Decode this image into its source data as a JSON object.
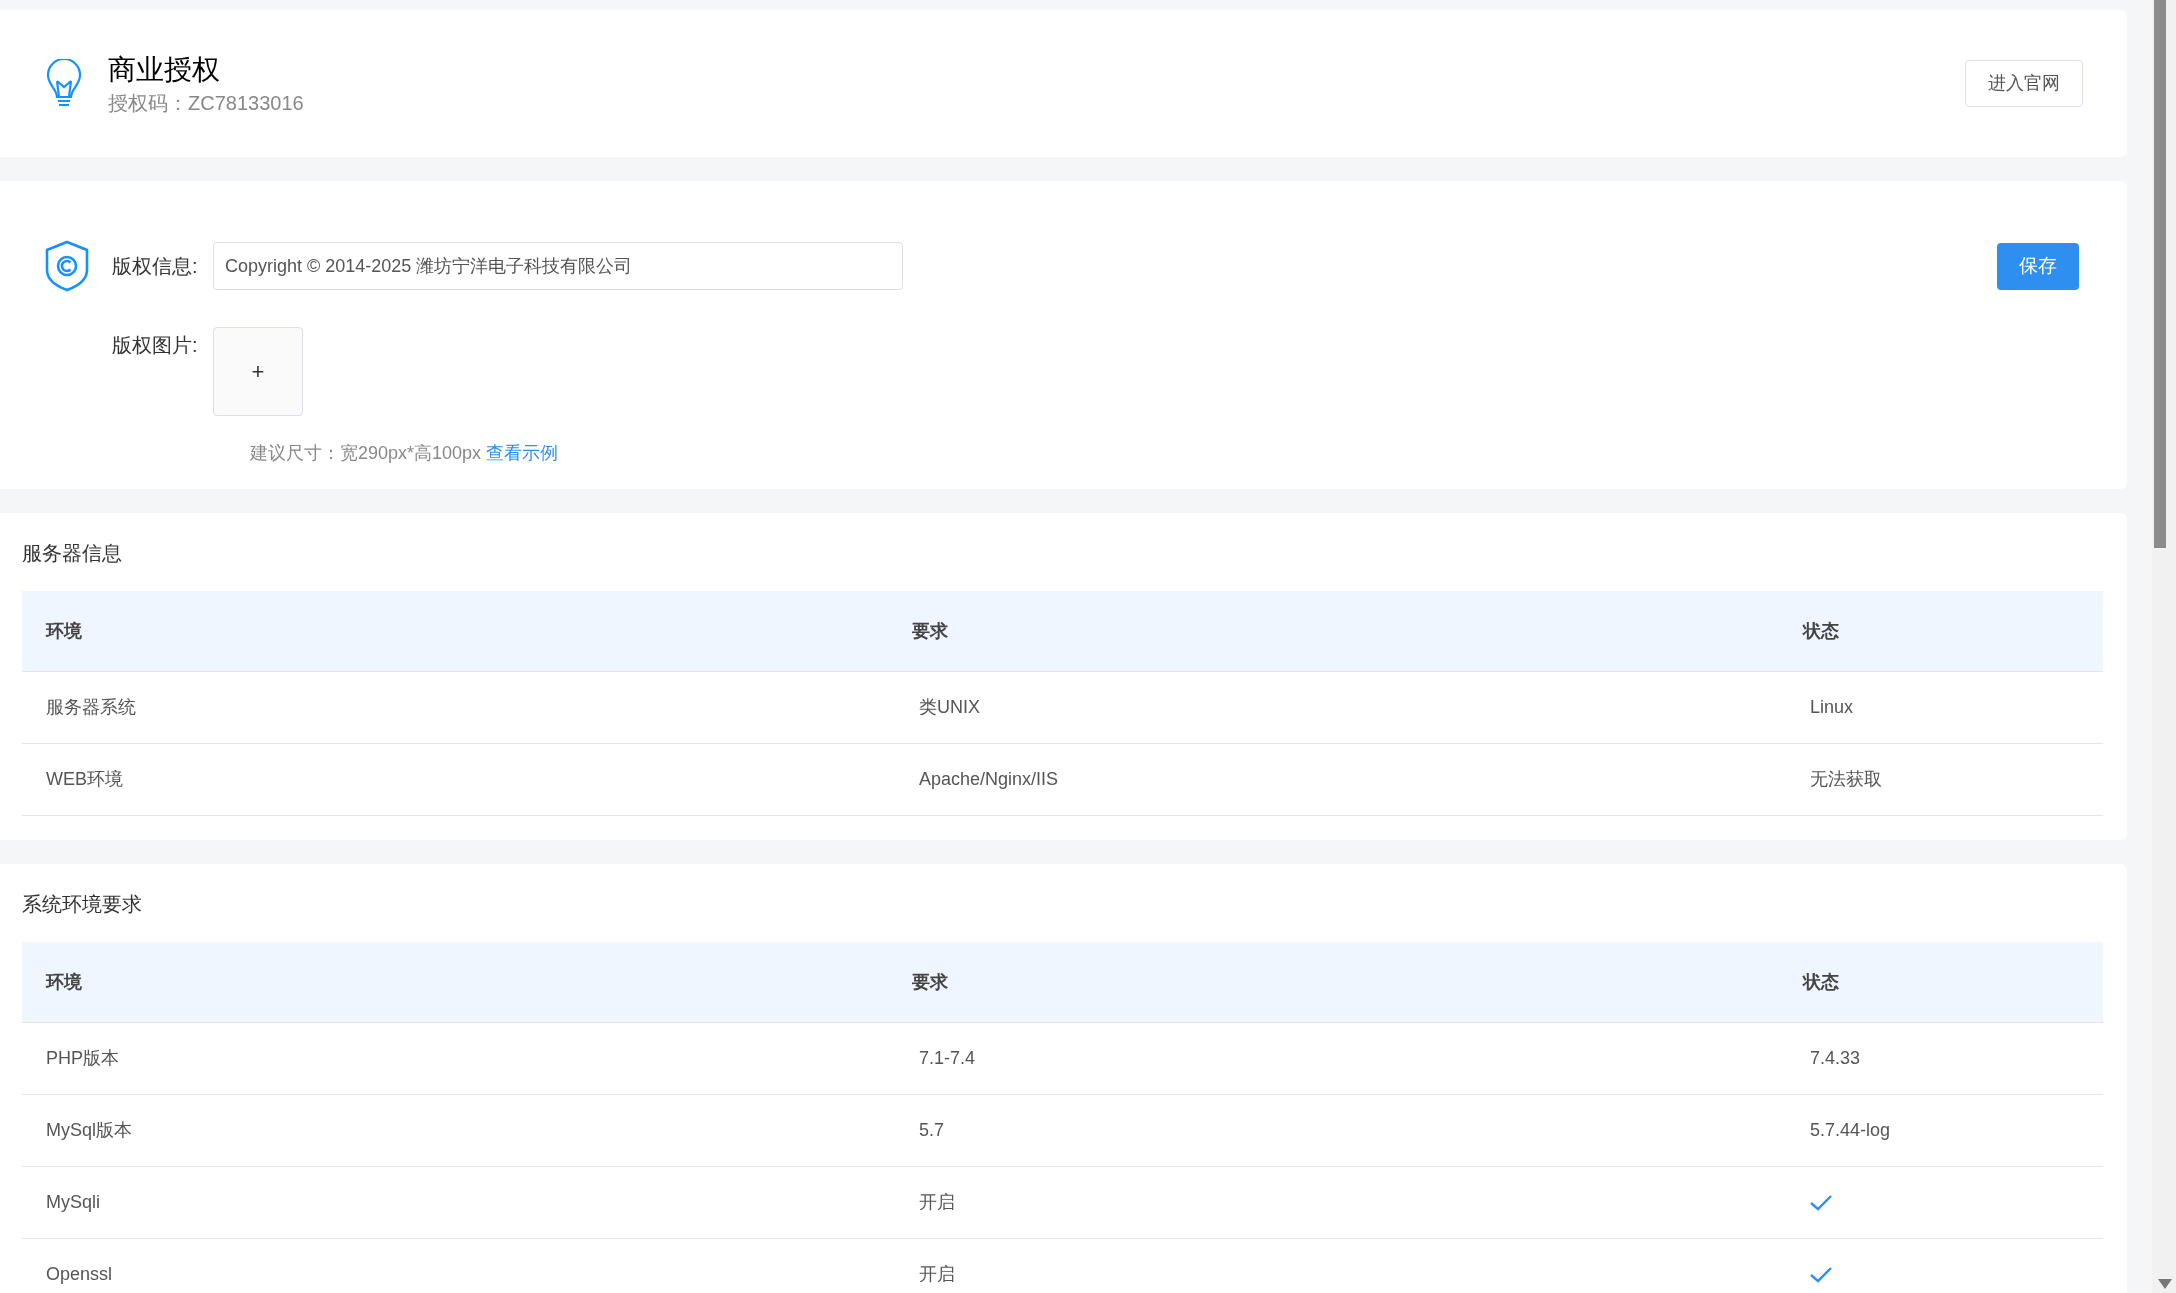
{
  "license": {
    "title": "商业授权",
    "code": "授权码：ZC78133016",
    "button": "进入官网"
  },
  "copyright": {
    "info_label": "版权信息:",
    "info_value": "Copyright © 2014-2025 潍坊宁洋电子科技有限公司",
    "save_button": "保存",
    "image_label": "版权图片:",
    "upload_symbol": "+",
    "hint": "建议尺寸：宽290px*高100px",
    "hint_link": "查看示例"
  },
  "tables": [
    {
      "title": "服务器信息",
      "columns": [
        "环境",
        "要求",
        "状态"
      ],
      "rows": [
        {
          "environment": "服务器系统",
          "requirement": "类UNIX",
          "status": {
            "kind": "text",
            "text": "Linux"
          }
        },
        {
          "environment": "WEB环境",
          "requirement": "Apache/Nginx/IIS",
          "status": {
            "kind": "text",
            "text": "无法获取"
          }
        }
      ]
    },
    {
      "title": "系统环境要求",
      "columns": [
        "环境",
        "要求",
        "状态"
      ],
      "rows": [
        {
          "environment": "PHP版本",
          "requirement": "7.1-7.4",
          "status": {
            "kind": "text",
            "text": "7.4.33"
          }
        },
        {
          "environment": "MySql版本",
          "requirement": "5.7",
          "status": {
            "kind": "text",
            "text": "5.7.44-log"
          }
        },
        {
          "environment": "MySqli",
          "requirement": "开启",
          "status": {
            "kind": "check"
          }
        },
        {
          "environment": "Openssl",
          "requirement": "开启",
          "status": {
            "kind": "check"
          }
        }
      ]
    }
  ]
}
